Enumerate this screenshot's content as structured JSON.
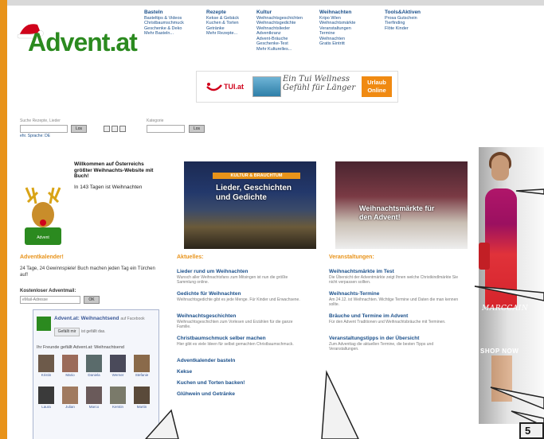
{
  "site": {
    "logo_text": "Advent",
    "logo_tld": ".at"
  },
  "nav": [
    {
      "head": "Basteln",
      "items": [
        "Basteltips & Videos",
        "Christbaumschmuck",
        "Geschenke & Deko",
        "Mehr Basteln..."
      ]
    },
    {
      "head": "Rezepte",
      "items": [
        "Kekse & Gebäck",
        "Kuchen & Torten",
        "Getränke",
        "Mehr Rezepte..."
      ]
    },
    {
      "head": "Kultur",
      "items": [
        "Weihnachtsgeschichten",
        "Weihnachtsgedichte",
        "Weihnachtslieder",
        "Adventkranz",
        "Advent-Bräuche",
        "Geschenke-Test",
        "Mehr Kulturelles..."
      ]
    },
    {
      "head": "Weihnachten",
      "items": [
        "Kripo Wien",
        "Weihnachtsmärkte",
        "Veranstaltungen",
        "Termine",
        "Weihnachten",
        "Gratis Eintritt"
      ]
    },
    {
      "head": "Tools&Aktiven",
      "items": [
        "Prosa Gutschein",
        "Tierfinding",
        "Flöte Kinder"
      ]
    }
  ],
  "banner": {
    "brand": "TUI.at",
    "script_text": "Ein Tui Wellness Gefühl für Länger",
    "cta": "Urlaub Online"
  },
  "search": {
    "label_keyword": "Suche Rezepte, Lieder",
    "label_kategorie": "Kategorie",
    "go": "Los",
    "go2": "Los",
    "sub": "ehr. Sprache: DE"
  },
  "welcome": {
    "text": "Willkommen auf Österreichs größter Weihnachts-Website mit Buch!",
    "countdown": "In 143 Tagen ist Weihnachten"
  },
  "left": {
    "gewinnspiel_head": "Adventkalender!",
    "gewinnspiel_text": "24 Tage, 24 Gewinnspiele! Buch machen jeden Tag ein Türchen auf!",
    "newsletter_head": "Kostenloser Adventmail:",
    "newsletter_placeholder": "eMail-Adresse",
    "newsletter_btn": "OK"
  },
  "facebook": {
    "title": "Advent.at: Weihnachtsend",
    "sub": "auf Facebook",
    "like": "Gefällt mir",
    "count": "ist gefällt das.",
    "fans_label": "Ihr Freunde gefällt Advent.at: Weihnachtsend",
    "fans": [
      "Kristin",
      "Mario",
      "Daniela",
      "Werner",
      "Stefanie",
      "Laura",
      "Julian",
      "Marco",
      "Kerstin",
      "Martin"
    ]
  },
  "features": {
    "left_tag": "KULTUR & BRAUCHTUM",
    "left_overlay": "Lieder, Geschichten und Gedichte",
    "right_tag": "",
    "right_overlay": "Weihnachtsmärkte für den Advent!"
  },
  "columns": {
    "left_head": "Aktuelles:",
    "right_head": "Veranstaltungen:",
    "left_articles": [
      {
        "title": "Lieder rund um Weihnachten",
        "body": "Wunsch aller Weihnachtsfans zum Mitsingen ist nun die größte Sammlung online."
      },
      {
        "title": "Gedichte für Weihnachten",
        "body": "Weihnachtsgedichte gibt es jede Menge. Für Kinder und Erwachsene."
      },
      {
        "title": "Weihnachtsgeschichten",
        "body": "Weihnachtsgeschichten zum Vorlesen und Erzählen für die ganze Familie."
      },
      {
        "title": "Christbaumschmuck selber machen",
        "body": "Hier gibt es viele Ideen für selbst gemachten Christbaumschmuck."
      },
      {
        "title": "Adventkalender basteln",
        "body": ""
      },
      {
        "title": "Kekse",
        "body": ""
      },
      {
        "title": "Kuchen und Torten backen!",
        "body": ""
      },
      {
        "title": "Glühwein und Getränke",
        "body": ""
      }
    ],
    "right_articles": [
      {
        "title": "Weihnachtsmärkte im Test",
        "body": "Die Übersicht der Adventmärkte zeigt Ihnen welche Christkindlmärkte Sie nicht verpassen sollten."
      },
      {
        "title": "Weihnachts-Termine",
        "body": "Am 24.12. ist Weihnachten. Wichtige Termine und Daten die man kennen sollte."
      },
      {
        "title": "Bräuche und Termine im Advent",
        "body": "Für den Advent Traditionen und Weihnachtsbräuche mit Terminen."
      },
      {
        "title": "Veranstaltungstipps in der Übersicht",
        "body": "Zum Adventtag die aktuellen Termine, die besten Tipps und Veranstaltungen."
      }
    ]
  },
  "ad": {
    "brand": "MARCCAIN",
    "cta": "SHOP NOW"
  },
  "corner_label": "5"
}
